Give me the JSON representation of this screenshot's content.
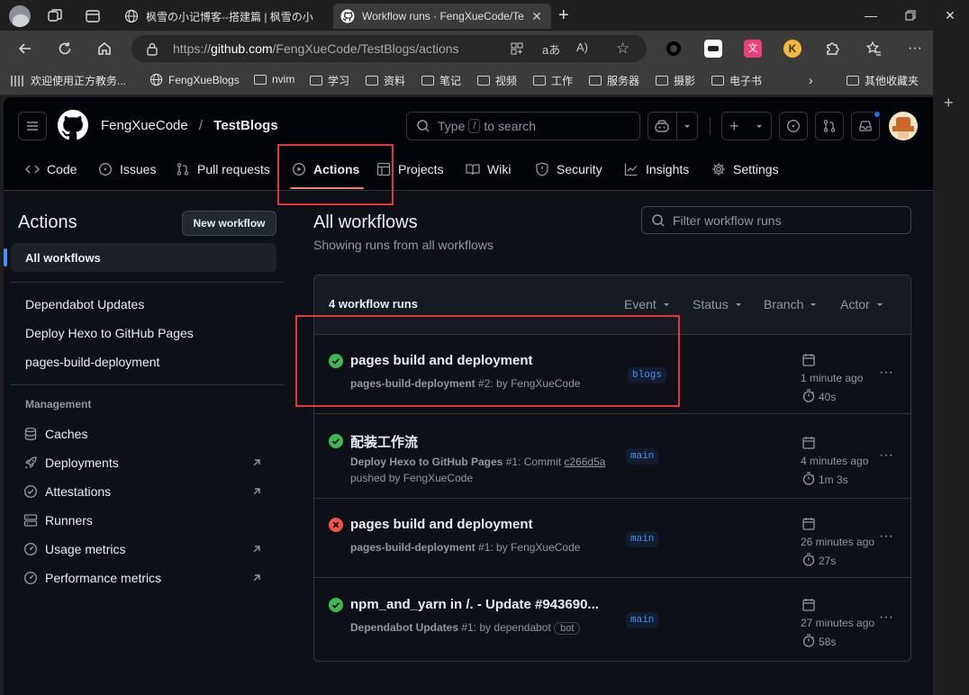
{
  "browser": {
    "tabs": [
      {
        "label": "枫雪の小记博客--搭建篇 | 枫雪の小"
      },
      {
        "label": "Workflow runs · FengXueCode/Te"
      }
    ],
    "url_prefix": "https://",
    "url_host": "github.com",
    "url_path": "/FengXueCode/TestBlogs/actions",
    "bookmarks": [
      "欢迎使用正方教务...",
      "FengXueBlogs",
      "nvim",
      "学习",
      "资料",
      "笔记",
      "视频",
      "工作",
      "服务器",
      "摄影",
      "电子书"
    ],
    "other_bookmarks": "其他收藏夹",
    "colors": {
      "chrome": "#1f1f1f",
      "toolbar": "#3b3b3b"
    }
  },
  "github": {
    "owner": "FengXueCode",
    "separator": "/",
    "repo": "TestBlogs",
    "search_placeholder_pre": "Type",
    "search_key": "/",
    "search_placeholder_post": "to search",
    "repo_nav": [
      "Code",
      "Issues",
      "Pull requests",
      "Actions",
      "Projects",
      "Wiki",
      "Security",
      "Insights",
      "Settings"
    ],
    "active_nav": "Actions"
  },
  "sidebar": {
    "title": "Actions",
    "new_workflow": "New workflow",
    "all_workflows": "All workflows",
    "workflows": [
      "Dependabot Updates",
      "Deploy Hexo to GitHub Pages",
      "pages-build-deployment"
    ],
    "management_title": "Management",
    "management": [
      {
        "label": "Caches",
        "icon": "database-icon",
        "external": false
      },
      {
        "label": "Deployments",
        "icon": "rocket-icon",
        "external": true
      },
      {
        "label": "Attestations",
        "icon": "verified-icon",
        "external": true
      },
      {
        "label": "Runners",
        "icon": "server-icon",
        "external": false
      },
      {
        "label": "Usage metrics",
        "icon": "meter-icon",
        "external": true
      },
      {
        "label": "Performance metrics",
        "icon": "meter-icon",
        "external": true
      }
    ]
  },
  "main": {
    "title": "All workflows",
    "subtitle": "Showing runs from all workflows",
    "filter_placeholder": "Filter workflow runs",
    "count_label": "4 workflow runs",
    "filters": [
      "Event",
      "Status",
      "Branch",
      "Actor"
    ],
    "runs": [
      {
        "status": "success",
        "title": "pages build and deployment",
        "workflow": "pages-build-deployment",
        "run": "#2",
        "detail": ": by FengXueCode",
        "detail2": "",
        "commit": "",
        "branch": "blogs",
        "time": "1 minute ago",
        "duration": "40s"
      },
      {
        "status": "success",
        "title": "配装工作流",
        "workflow": "Deploy Hexo to GitHub Pages",
        "run": "#1",
        "detail": ": Commit ",
        "commit": "c266d5a",
        "detail2": "pushed by FengXueCode",
        "branch": "main",
        "time": "4 minutes ago",
        "duration": "1m 3s"
      },
      {
        "status": "failure",
        "title": "pages build and deployment",
        "workflow": "pages-build-deployment",
        "run": "#1",
        "detail": ": by FengXueCode",
        "detail2": "",
        "commit": "",
        "branch": "main",
        "time": "26 minutes ago",
        "duration": "27s"
      },
      {
        "status": "success",
        "title": "npm_and_yarn in /. - Update #943690...",
        "workflow": "Dependabot Updates",
        "run": "#1",
        "detail": ": by dependabot",
        "bot_label": "bot",
        "detail2": "",
        "commit": "",
        "branch": "main",
        "time": "27 minutes ago",
        "duration": "58s"
      }
    ],
    "colors": {
      "success": "#3fb950",
      "failure": "#f85149",
      "accent": "#f78166",
      "highlight": "#e5343a"
    }
  }
}
